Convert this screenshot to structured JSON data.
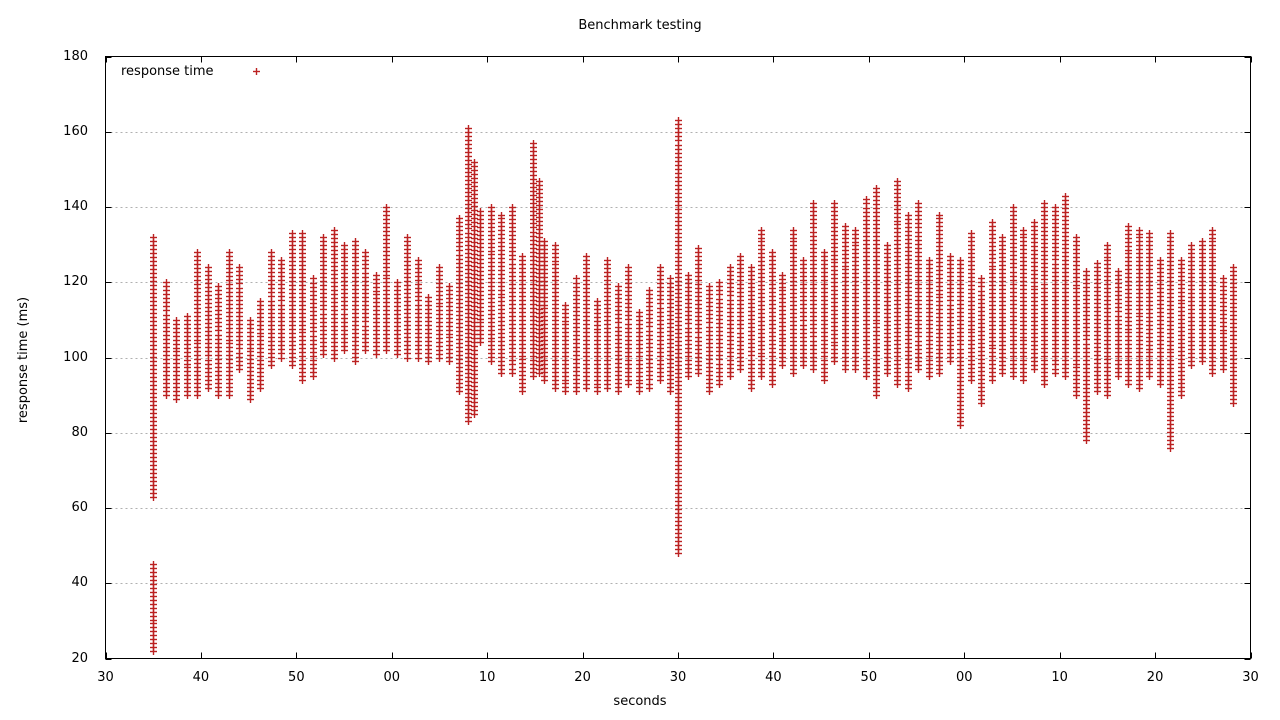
{
  "chart_data": {
    "type": "scatter",
    "title": "Benchmark testing",
    "xlabel": "seconds",
    "ylabel": "response time (ms)",
    "grid": true,
    "legend_position": "top-left-inside",
    "marker": "plus",
    "marker_color": "#bb2222",
    "border_color": "#000000",
    "gridline_color": "#b0b0b0",
    "background": "#ffffff",
    "xlim": [
      0,
      120
    ],
    "ylim": [
      20,
      180
    ],
    "ytick_step": 20,
    "xtick_step": 10,
    "xtick_labels": [
      "30",
      "40",
      "50",
      "00",
      "10",
      "20",
      "30",
      "40",
      "50",
      "00",
      "10",
      "20",
      "30"
    ],
    "xtick_values": [
      0,
      10,
      20,
      30,
      40,
      50,
      60,
      70,
      80,
      90,
      100,
      110,
      120
    ],
    "ytick_labels": [
      "20",
      "40",
      "60",
      "80",
      "100",
      "120",
      "140",
      "160",
      "180"
    ],
    "ytick_values": [
      20,
      40,
      60,
      80,
      100,
      120,
      140,
      160,
      180
    ],
    "series": [
      {
        "name": "response time",
        "columns": [
          {
            "x": 5.0,
            "ymin": 63,
            "ymax": 132
          },
          {
            "x": 5.0,
            "ymin": 22,
            "ymax": 45
          },
          {
            "x": 6.3,
            "ymin": 90,
            "ymax": 120
          },
          {
            "x": 7.4,
            "ymin": 89,
            "ymax": 110
          },
          {
            "x": 8.5,
            "ymin": 90,
            "ymax": 111
          },
          {
            "x": 9.6,
            "ymin": 90,
            "ymax": 128
          },
          {
            "x": 10.7,
            "ymin": 92,
            "ymax": 124
          },
          {
            "x": 11.8,
            "ymin": 90,
            "ymax": 119
          },
          {
            "x": 12.9,
            "ymin": 90,
            "ymax": 128
          },
          {
            "x": 14.0,
            "ymin": 97,
            "ymax": 124
          },
          {
            "x": 15.1,
            "ymin": 89,
            "ymax": 110
          },
          {
            "x": 16.2,
            "ymin": 92,
            "ymax": 115
          },
          {
            "x": 17.3,
            "ymin": 98,
            "ymax": 128
          },
          {
            "x": 18.4,
            "ymin": 100,
            "ymax": 126
          },
          {
            "x": 19.5,
            "ymin": 98,
            "ymax": 133
          },
          {
            "x": 20.6,
            "ymin": 94,
            "ymax": 133
          },
          {
            "x": 21.7,
            "ymin": 95,
            "ymax": 121
          },
          {
            "x": 22.8,
            "ymin": 101,
            "ymax": 132
          },
          {
            "x": 23.9,
            "ymin": 100,
            "ymax": 134
          },
          {
            "x": 25.0,
            "ymin": 102,
            "ymax": 130
          },
          {
            "x": 26.1,
            "ymin": 99,
            "ymax": 131
          },
          {
            "x": 27.2,
            "ymin": 102,
            "ymax": 128
          },
          {
            "x": 28.3,
            "ymin": 101,
            "ymax": 122
          },
          {
            "x": 29.4,
            "ymin": 102,
            "ymax": 140
          },
          {
            "x": 30.5,
            "ymin": 101,
            "ymax": 120
          },
          {
            "x": 31.6,
            "ymin": 100,
            "ymax": 132
          },
          {
            "x": 32.7,
            "ymin": 100,
            "ymax": 126
          },
          {
            "x": 33.8,
            "ymin": 99,
            "ymax": 116
          },
          {
            "x": 34.9,
            "ymin": 100,
            "ymax": 124
          },
          {
            "x": 36.0,
            "ymin": 99,
            "ymax": 119
          },
          {
            "x": 37.1,
            "ymin": 91,
            "ymax": 137
          },
          {
            "x": 38.0,
            "ymin": 83,
            "ymax": 161
          },
          {
            "x": 38.6,
            "ymin": 85,
            "ymax": 152
          },
          {
            "x": 39.3,
            "ymin": 104,
            "ymax": 139
          },
          {
            "x": 40.4,
            "ymin": 99,
            "ymax": 140
          },
          {
            "x": 41.5,
            "ymin": 96,
            "ymax": 138
          },
          {
            "x": 42.6,
            "ymin": 96,
            "ymax": 140
          },
          {
            "x": 43.7,
            "ymin": 91,
            "ymax": 127
          },
          {
            "x": 44.8,
            "ymin": 95,
            "ymax": 157
          },
          {
            "x": 45.4,
            "ymin": 96,
            "ymax": 147
          },
          {
            "x": 46.0,
            "ymin": 94,
            "ymax": 131
          },
          {
            "x": 47.1,
            "ymin": 92,
            "ymax": 130
          },
          {
            "x": 48.2,
            "ymin": 91,
            "ymax": 114
          },
          {
            "x": 49.3,
            "ymin": 91,
            "ymax": 121
          },
          {
            "x": 50.4,
            "ymin": 92,
            "ymax": 127
          },
          {
            "x": 51.5,
            "ymin": 91,
            "ymax": 115
          },
          {
            "x": 52.6,
            "ymin": 92,
            "ymax": 126
          },
          {
            "x": 53.7,
            "ymin": 91,
            "ymax": 119
          },
          {
            "x": 54.8,
            "ymin": 93,
            "ymax": 124
          },
          {
            "x": 55.9,
            "ymin": 91,
            "ymax": 112
          },
          {
            "x": 57.0,
            "ymin": 92,
            "ymax": 118
          },
          {
            "x": 58.1,
            "ymin": 94,
            "ymax": 124
          },
          {
            "x": 59.2,
            "ymin": 91,
            "ymax": 121
          },
          {
            "x": 60.0,
            "ymin": 48,
            "ymax": 163
          },
          {
            "x": 61.0,
            "ymin": 95,
            "ymax": 122
          },
          {
            "x": 62.1,
            "ymin": 96,
            "ymax": 129
          },
          {
            "x": 63.2,
            "ymin": 91,
            "ymax": 119
          },
          {
            "x": 64.3,
            "ymin": 93,
            "ymax": 120
          },
          {
            "x": 65.4,
            "ymin": 95,
            "ymax": 124
          },
          {
            "x": 66.5,
            "ymin": 97,
            "ymax": 127
          },
          {
            "x": 67.6,
            "ymin": 92,
            "ymax": 124
          },
          {
            "x": 68.7,
            "ymin": 95,
            "ymax": 134
          },
          {
            "x": 69.8,
            "ymin": 93,
            "ymax": 128
          },
          {
            "x": 70.9,
            "ymin": 98,
            "ymax": 122
          },
          {
            "x": 72.0,
            "ymin": 96,
            "ymax": 134
          },
          {
            "x": 73.1,
            "ymin": 98,
            "ymax": 126
          },
          {
            "x": 74.2,
            "ymin": 97,
            "ymax": 141
          },
          {
            "x": 75.3,
            "ymin": 94,
            "ymax": 128
          },
          {
            "x": 76.4,
            "ymin": 99,
            "ymax": 141
          },
          {
            "x": 77.5,
            "ymin": 97,
            "ymax": 135
          },
          {
            "x": 78.6,
            "ymin": 97,
            "ymax": 134
          },
          {
            "x": 79.7,
            "ymin": 95,
            "ymax": 142
          },
          {
            "x": 80.8,
            "ymin": 90,
            "ymax": 145
          },
          {
            "x": 81.9,
            "ymin": 96,
            "ymax": 130
          },
          {
            "x": 83.0,
            "ymin": 93,
            "ymax": 147
          },
          {
            "x": 84.1,
            "ymin": 92,
            "ymax": 138
          },
          {
            "x": 85.2,
            "ymin": 97,
            "ymax": 141
          },
          {
            "x": 86.3,
            "ymin": 95,
            "ymax": 126
          },
          {
            "x": 87.4,
            "ymin": 96,
            "ymax": 138
          },
          {
            "x": 88.5,
            "ymin": 99,
            "ymax": 127
          },
          {
            "x": 89.6,
            "ymin": 82,
            "ymax": 126
          },
          {
            "x": 90.7,
            "ymin": 94,
            "ymax": 133
          },
          {
            "x": 91.8,
            "ymin": 88,
            "ymax": 121
          },
          {
            "x": 92.9,
            "ymin": 94,
            "ymax": 136
          },
          {
            "x": 94.0,
            "ymin": 96,
            "ymax": 132
          },
          {
            "x": 95.1,
            "ymin": 95,
            "ymax": 140
          },
          {
            "x": 96.2,
            "ymin": 94,
            "ymax": 134
          },
          {
            "x": 97.3,
            "ymin": 97,
            "ymax": 136
          },
          {
            "x": 98.4,
            "ymin": 93,
            "ymax": 141
          },
          {
            "x": 99.5,
            "ymin": 96,
            "ymax": 140
          },
          {
            "x": 100.6,
            "ymin": 95,
            "ymax": 143
          },
          {
            "x": 101.7,
            "ymin": 90,
            "ymax": 132
          },
          {
            "x": 102.8,
            "ymin": 78,
            "ymax": 123
          },
          {
            "x": 103.9,
            "ymin": 91,
            "ymax": 125
          },
          {
            "x": 105.0,
            "ymin": 90,
            "ymax": 130
          },
          {
            "x": 106.1,
            "ymin": 95,
            "ymax": 123
          },
          {
            "x": 107.2,
            "ymin": 93,
            "ymax": 135
          },
          {
            "x": 108.3,
            "ymin": 92,
            "ymax": 134
          },
          {
            "x": 109.4,
            "ymin": 95,
            "ymax": 133
          },
          {
            "x": 110.5,
            "ymin": 93,
            "ymax": 126
          },
          {
            "x": 111.6,
            "ymin": 76,
            "ymax": 133
          },
          {
            "x": 112.7,
            "ymin": 90,
            "ymax": 126
          },
          {
            "x": 113.8,
            "ymin": 98,
            "ymax": 130
          },
          {
            "x": 114.9,
            "ymin": 99,
            "ymax": 131
          },
          {
            "x": 116.0,
            "ymin": 96,
            "ymax": 134
          },
          {
            "x": 117.1,
            "ymin": 97,
            "ymax": 121
          },
          {
            "x": 118.2,
            "ymin": 88,
            "ymax": 124
          }
        ]
      }
    ]
  },
  "legend": {
    "entry_label": "response time"
  }
}
